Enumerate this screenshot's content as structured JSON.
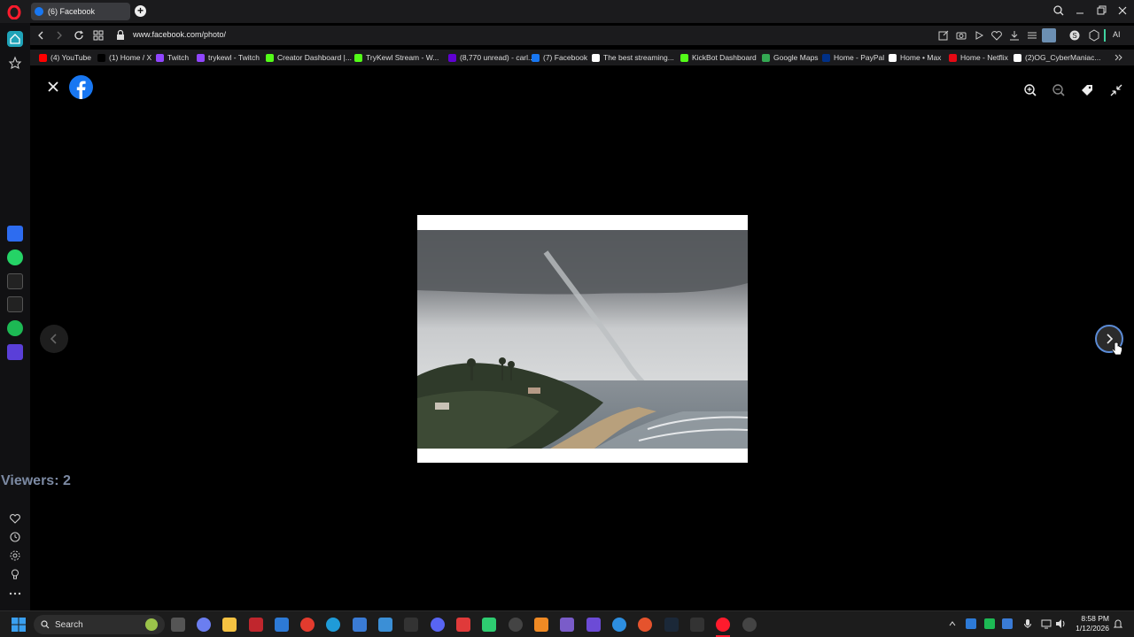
{
  "browser": {
    "tab_title": "(6) Facebook",
    "url": "www.facebook.com/photo/",
    "ai_label": "AI"
  },
  "bookmarks": [
    {
      "label": "(4) YouTube",
      "color": "#ff0000"
    },
    {
      "label": "(1) Home / X",
      "color": "#000000"
    },
    {
      "label": "Twitch",
      "color": "#9146ff"
    },
    {
      "label": "trykewl - Twitch",
      "color": "#9146ff"
    },
    {
      "label": "Creator Dashboard |...",
      "color": "#53fc18"
    },
    {
      "label": "TryKewl Stream - W...",
      "color": "#53fc18"
    },
    {
      "label": "(8,770 unread) - carl...",
      "color": "#6001d2"
    },
    {
      "label": "(7) Facebook",
      "color": "#1877f2"
    },
    {
      "label": "The best streaming...",
      "color": "#ffffff"
    },
    {
      "label": "KickBot Dashboard",
      "color": "#53fc18"
    },
    {
      "label": "Google Maps",
      "color": "#34a853"
    },
    {
      "label": "Home - PayPal",
      "color": "#003087"
    },
    {
      "label": "Home • Max",
      "color": "#ffffff"
    },
    {
      "label": "Home - Netflix",
      "color": "#e50914"
    },
    {
      "label": "(2)OG_CyberManiac...",
      "color": "#ffffff"
    }
  ],
  "viewer": {
    "viewers_text": "Viewers: 2"
  },
  "taskbar": {
    "search_placeholder": "Search",
    "time": "8:58 PM",
    "date": "1/12/2026"
  }
}
